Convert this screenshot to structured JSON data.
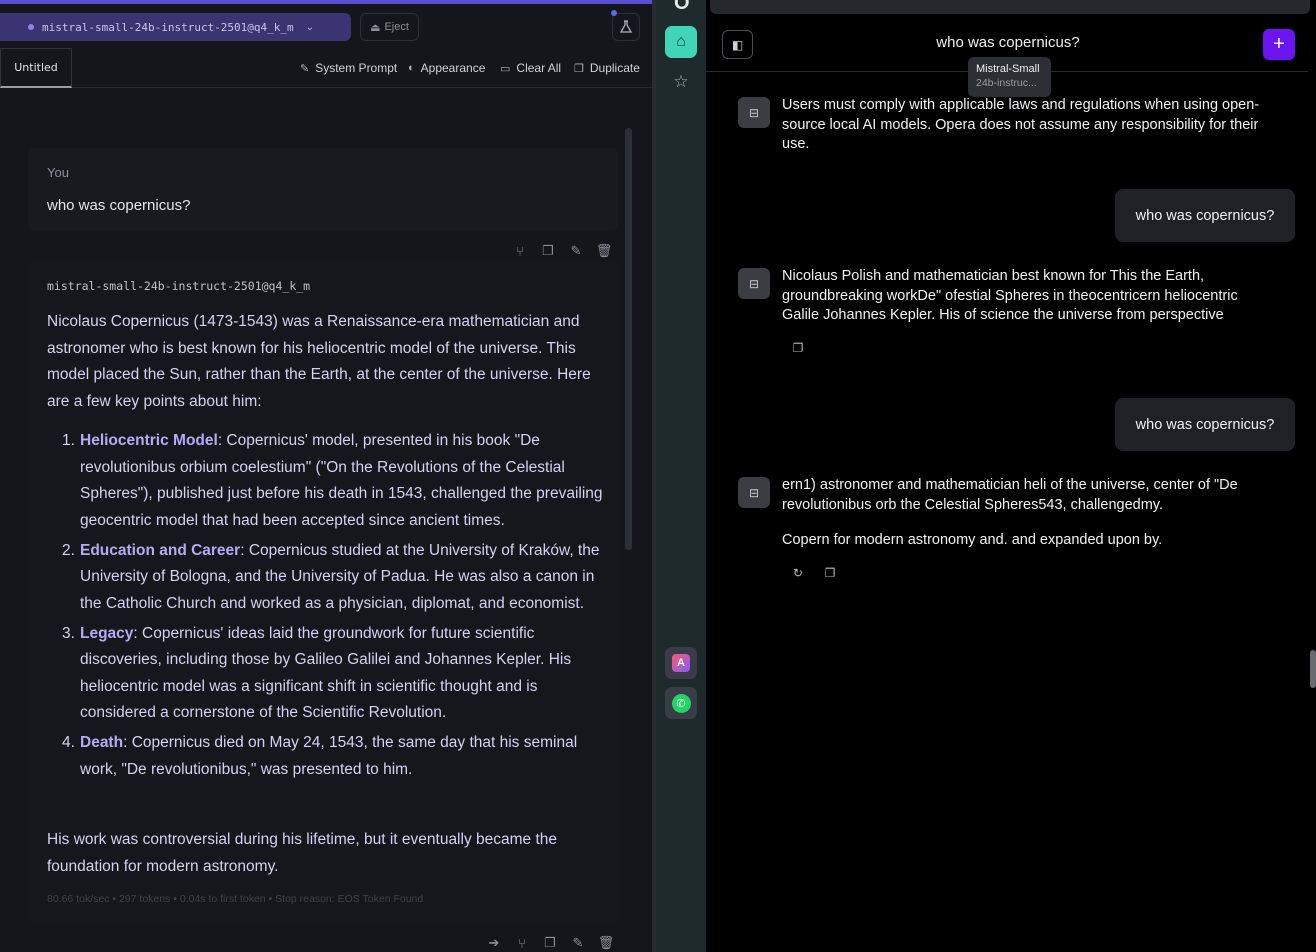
{
  "lmstudio": {
    "model_selector": "mistral-small-24b-instruct-2501@q4_k_m",
    "eject_label": "Eject",
    "tab_label": "Untitled",
    "toolbar": {
      "system_prompt": "System Prompt",
      "appearance": "Appearance",
      "clear_all": "Clear All",
      "duplicate": "Duplicate"
    },
    "user_message": {
      "role": "You",
      "text": "who was copernicus?"
    },
    "assistant_message": {
      "model": "mistral-small-24b-instruct-2501@q4_k_m",
      "intro": "Nicolaus Copernicus (1473-1543) was a Renaissance-era mathematician and astronomer who is best known for his heliocentric model of the universe. This model placed the Sun, rather than the Earth, at the center of the universe. Here are a few key points about him:",
      "points": [
        {
          "num": "1.",
          "title": "Heliocentric Model",
          "text": ": Copernicus' model, presented in his book \"De revolutionibus orbium coelestium\" (\"On the Revolutions of the Celestial Spheres\"), published just before his death in 1543, challenged the prevailing geocentric model that had been accepted since ancient times."
        },
        {
          "num": "2.",
          "title": "Education and Career",
          "text": ": Copernicus studied at the University of Kraków, the University of Bologna, and the University of Padua. He was also a canon in the Catholic Church and worked as a physician, diplomat, and economist."
        },
        {
          "num": "3.",
          "title": "Legacy",
          "text": ": Copernicus' ideas laid the groundwork for future scientific discoveries, including those by Galileo Galilei and Johannes Kepler. His heliocentric model was a significant shift in scientific thought and is considered a cornerstone of the Scientific Revolution."
        },
        {
          "num": "4.",
          "title": "Death",
          "text": ": Copernicus died on May 24, 1543, the same day that his seminal work, \"De revolutionibus,\" was presented to him."
        }
      ],
      "outro": "His work was controversial during his lifetime, but it eventually became the foundation for modern astronomy.",
      "stats": "80.66 tok/sec • 297 tokens • 0.04s to first token • Stop reason: EOS Token Found"
    }
  },
  "opera_sidebar": {
    "logo": "O",
    "icons": [
      "home-icon",
      "star-icon",
      "aria-icon",
      "whatsapp-icon"
    ]
  },
  "aria": {
    "chat_title": "who was copernicus?",
    "tooltip": {
      "line1": "Mistral-Small",
      "line2": "24b-instruc..."
    },
    "messages": [
      {
        "role": "bot",
        "text": "Users must comply with applicable laws and regulations when using open-source local AI models. Opera does not assume any responsibility for their use."
      },
      {
        "role": "user",
        "text": "who was copernicus?"
      },
      {
        "role": "bot",
        "text": "Nicolaus Polish and mathematician best known for This the Earth, groundbreaking workDe\" ofestial Spheres in theocentricern heliocentric Galile Johannes Kepler. His of science the universe from perspective"
      },
      {
        "role": "user",
        "text": "who was copernicus?"
      },
      {
        "role": "bot",
        "text": "ern1) astronomer and mathematician heli of the universe, center of \"De revolutionibus orb the Celestial Spheres543, challengedmy.",
        "text2": "Copern for modern astronomy and. and expanded upon by."
      }
    ]
  },
  "colors": {
    "lm_accent": "#5a4fcf",
    "opera_home": "#3fd5b6",
    "aria_new_chat": "#6a14f0"
  }
}
